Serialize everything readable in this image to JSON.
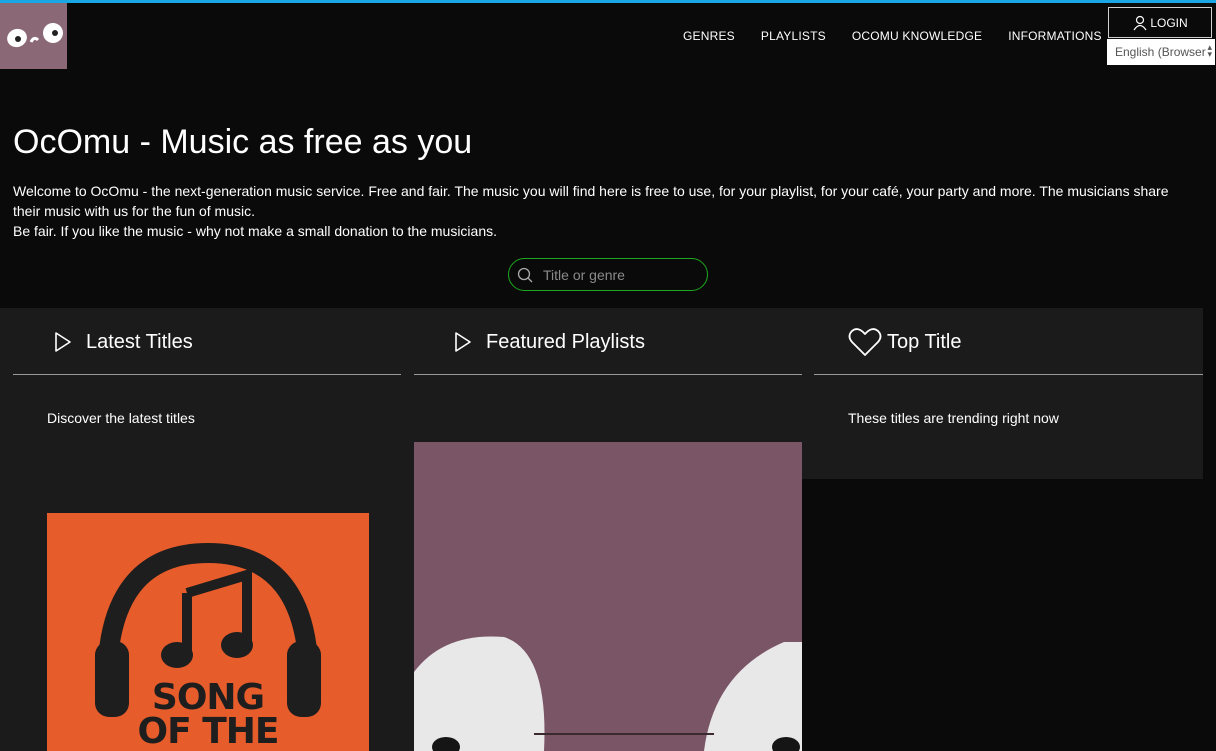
{
  "brand": {
    "logo_text": "OcO"
  },
  "nav": {
    "items": [
      "GENRES",
      "PLAYLISTS",
      "OCOMU KNOWLEDGE",
      "INFORMATIONS"
    ],
    "login_label": "LOGIN",
    "language": "English (Browser"
  },
  "hero": {
    "title": "OcOmu - Music as free as you",
    "intro_line1": "Welcome to OcOmu - the next-generation music service. Free and fair. The music you will find here is free to use, for your playlist, for your café, your party and more. The musicians share their music with us for the fun of music.",
    "intro_line2": "Be fair. If you like the music - why not make a small donation to the musicians."
  },
  "search": {
    "placeholder": "Title or genre"
  },
  "sections": {
    "latest": {
      "title": "Latest Titles",
      "description": "Discover the latest titles",
      "art_text_1": "SONG",
      "art_text_2": "OF THE"
    },
    "featured": {
      "title": "Featured Playlists"
    },
    "top": {
      "title": "Top Title",
      "description": "These titles are trending right now"
    }
  },
  "colors": {
    "accent": "#19a7e6",
    "search_border": "#1ea81e",
    "song_art": "#e65c2b",
    "playlist_art": "#7a5566"
  }
}
